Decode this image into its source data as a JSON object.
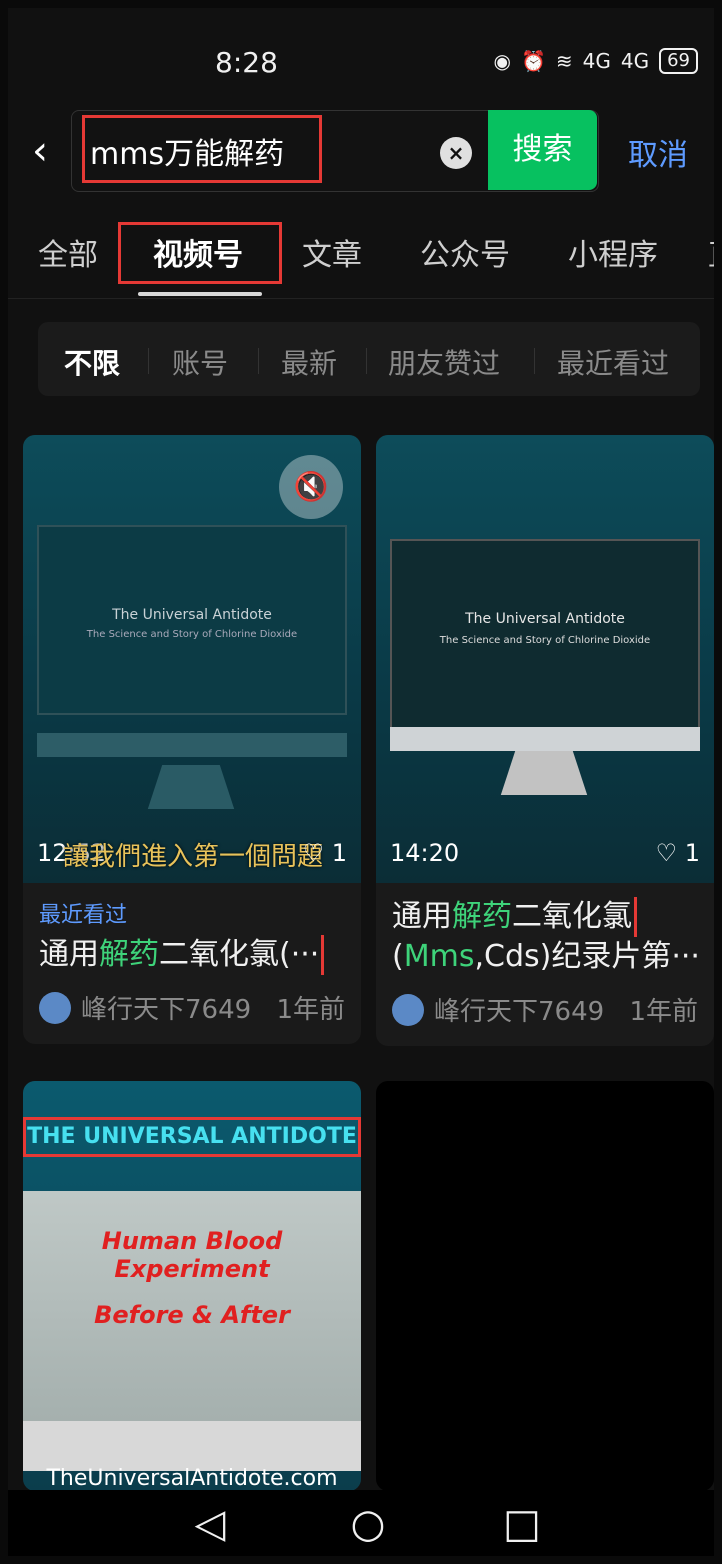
{
  "status": {
    "time": "8:28",
    "network1": "⁶",
    "net4g1": "4G",
    "net4g2": "4G",
    "battery": "69"
  },
  "search": {
    "query": "mms万能解药",
    "button": "搜索",
    "cancel": "取消",
    "back_icon": "‹"
  },
  "tabs": [
    "全部",
    "视频号",
    "文章",
    "公众号",
    "小程序",
    "直"
  ],
  "filters": [
    "不限",
    "账号",
    "最新",
    "朋友赞过",
    "最近看过"
  ],
  "cards": [
    {
      "monitor_title": "The Universal Antidote",
      "monitor_sub": "The Science and Story of Chlorine Dioxide",
      "duration": "12:52",
      "caption": "讓我們進入第一個問題",
      "likes": "♡ 1",
      "recent": "最近看过",
      "title_prefix": "通用",
      "title_hl": "解药",
      "title_suffix": "二氧化氯(···",
      "author": "峰行天下7649",
      "time_ago": "1年前"
    },
    {
      "monitor_title": "The Universal Antidote",
      "monitor_sub": "The Science and Story of Chlorine Dioxide",
      "duration": "14:20",
      "likes": "♡ 1",
      "title_prefix": "通用",
      "title_hl": "解药",
      "title_suffix": "二氧化氯",
      "title_line2_hl": "Mms",
      "title_line2_a": "(",
      "title_line2_b": ",Cds)纪录片第···",
      "author": "峰行天下7649",
      "time_ago": "1年前"
    },
    {
      "banner": "THE UNIVERSAL ANTIDOTE",
      "red1": "Human Blood Experiment",
      "red2": "Before & After",
      "logo": "",
      "url": "TheUniversalAntidote.com"
    }
  ],
  "nav": {
    "back": "◁",
    "home": "○",
    "recents": "□"
  }
}
